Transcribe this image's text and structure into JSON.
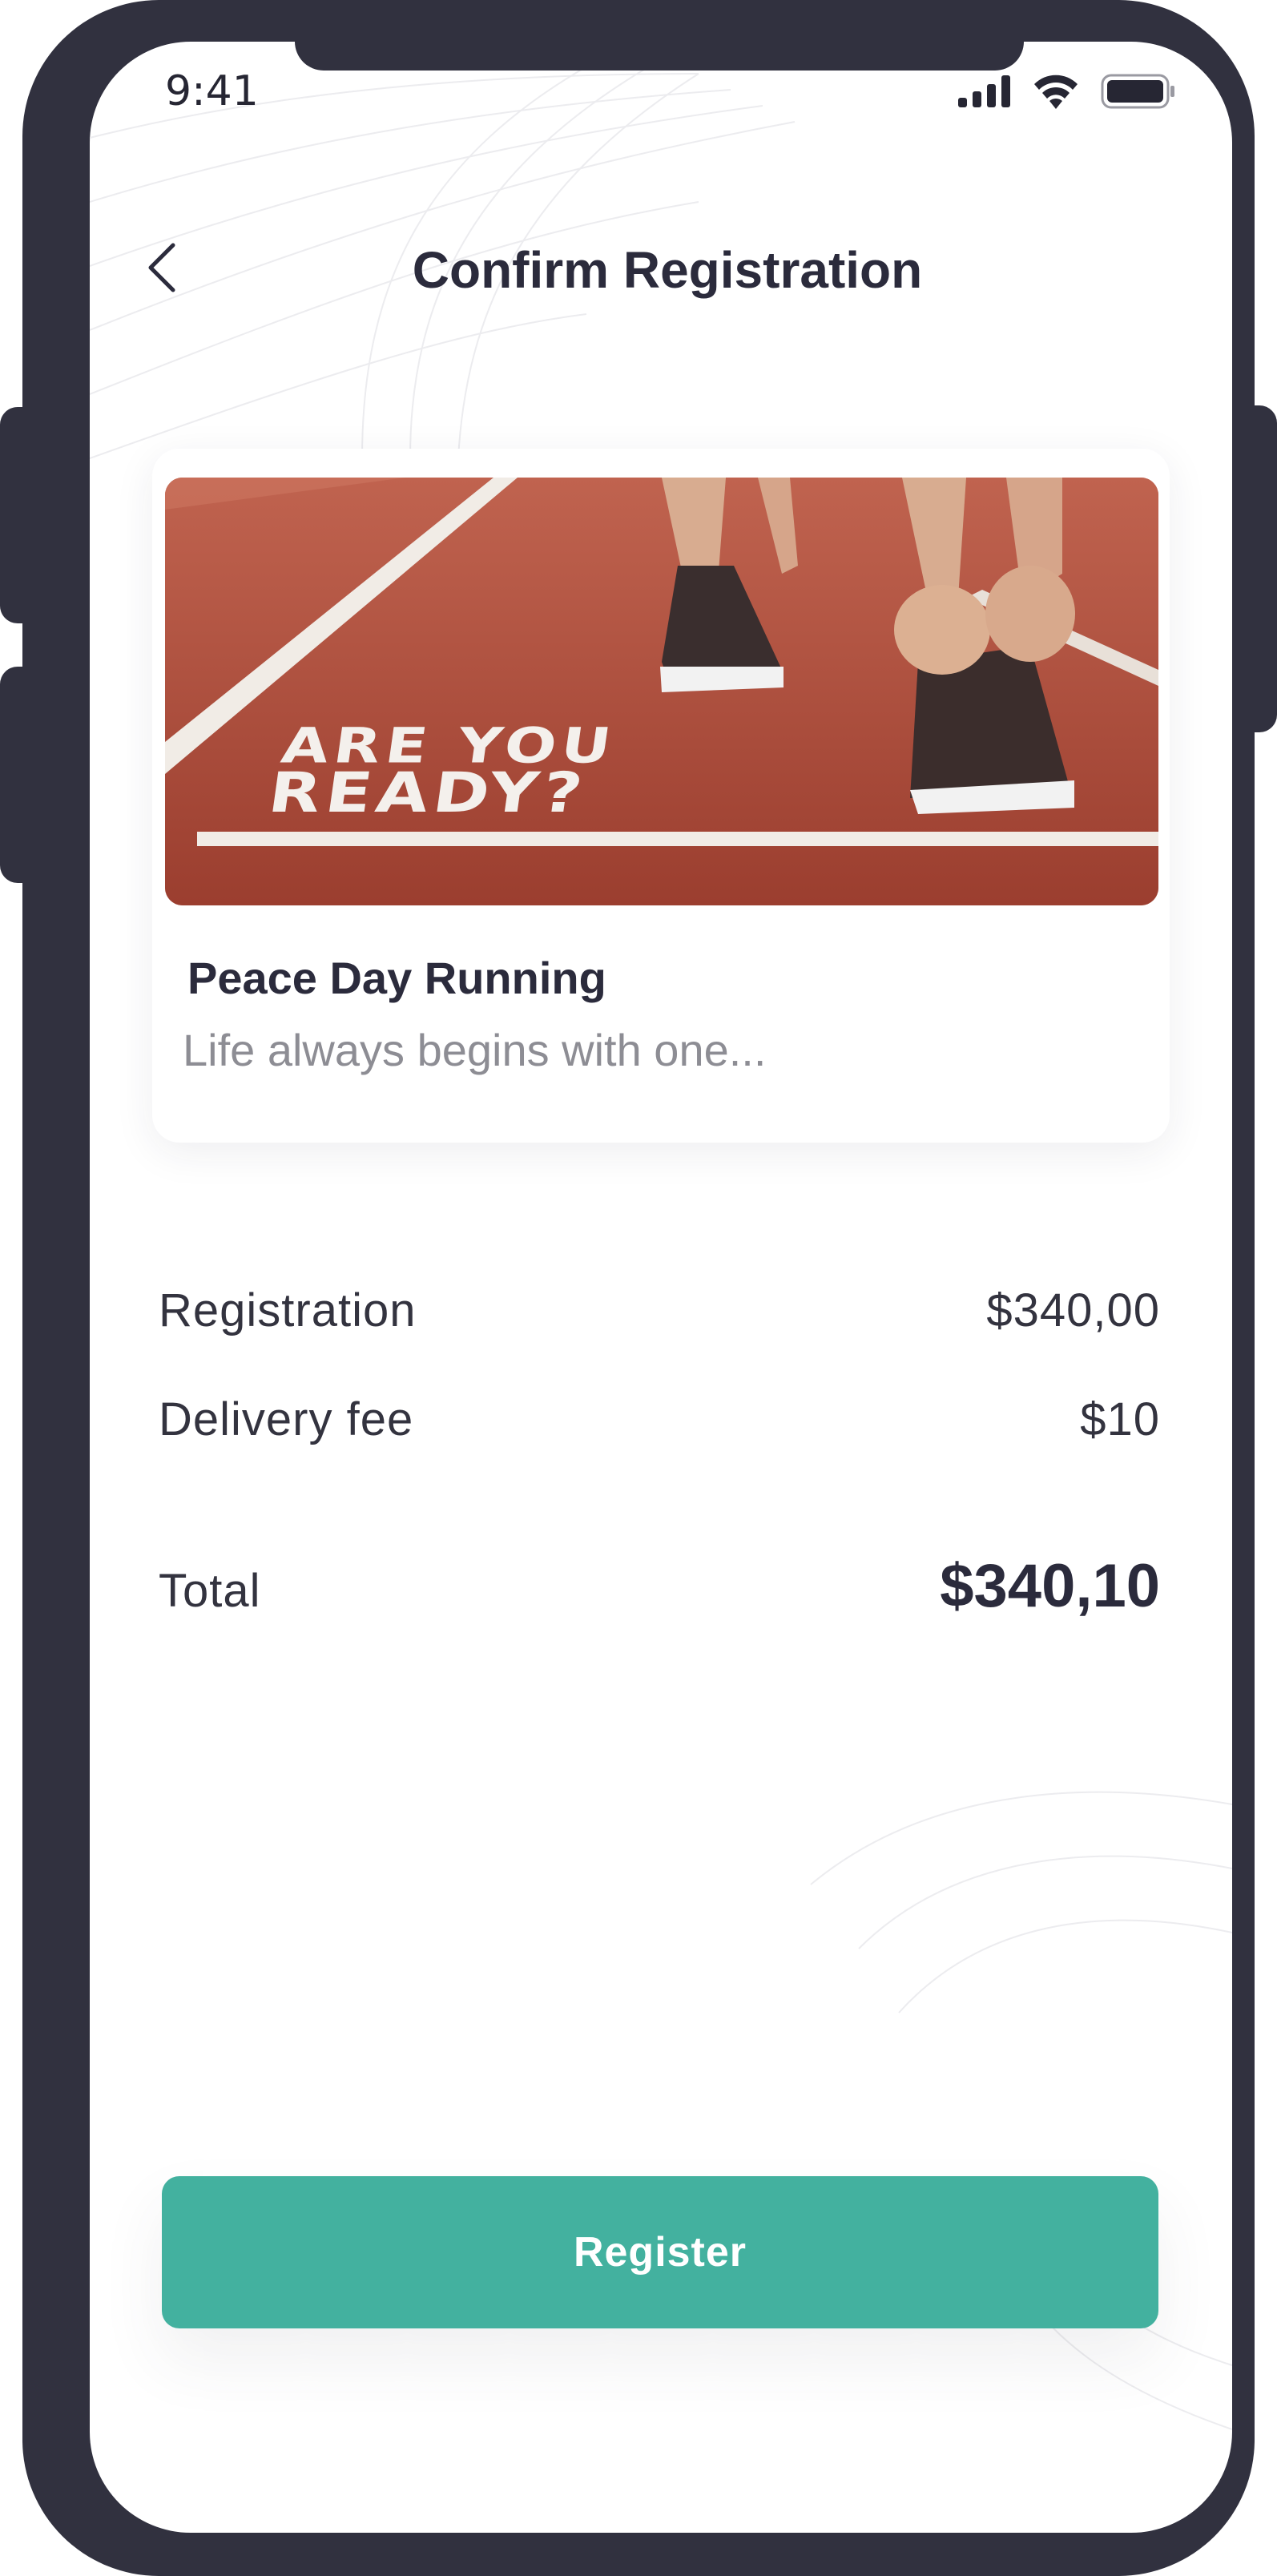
{
  "status_bar": {
    "time": "9:41",
    "icons": [
      "cellular-signal-icon",
      "wifi-icon",
      "battery-icon"
    ]
  },
  "header": {
    "back_icon": "chevron-left-icon",
    "title": "Confirm Registration"
  },
  "event": {
    "image_text_line1": "ARE YOU",
    "image_text_line2": "READY?",
    "title": "Peace Day Running",
    "subtitle": "Life always begins with one..."
  },
  "summary": {
    "registration_label": "Registration",
    "registration_value": "$340,00",
    "delivery_label": "Delivery fee",
    "delivery_value": "$10",
    "total_label": "Total",
    "total_value": "$340,10"
  },
  "actions": {
    "register_label": "Register"
  },
  "colors": {
    "accent": "#43b19f",
    "frame": "#31313f",
    "text_primary": "#2b2b3c",
    "text_secondary": "#8d8d94",
    "track": "#b5543f"
  }
}
